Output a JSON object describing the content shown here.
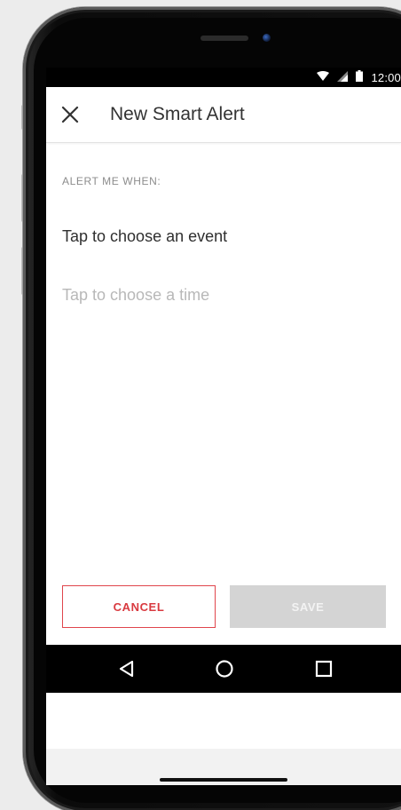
{
  "status_bar": {
    "time": "12:00",
    "wifi_icon": "wifi-icon",
    "signal_icon": "signal-icon",
    "battery_icon": "battery-icon"
  },
  "app_bar": {
    "close_icon": "close-icon",
    "title": "New Smart Alert"
  },
  "form": {
    "section_label": "ALERT ME WHEN:",
    "event_prompt": "Tap to choose an event",
    "time_prompt": "Tap to choose a time"
  },
  "actions": {
    "cancel_label": "CANCEL",
    "save_label": "SAVE"
  },
  "nav_bar": {
    "back_icon": "back-triangle-icon",
    "home_icon": "home-circle-icon",
    "recents_icon": "recents-square-icon"
  },
  "colors": {
    "accent_red": "#e0454c",
    "disabled_gray": "#d4d4d4",
    "muted_text": "#b8b8b8",
    "label_gray": "#8c8c8c"
  }
}
